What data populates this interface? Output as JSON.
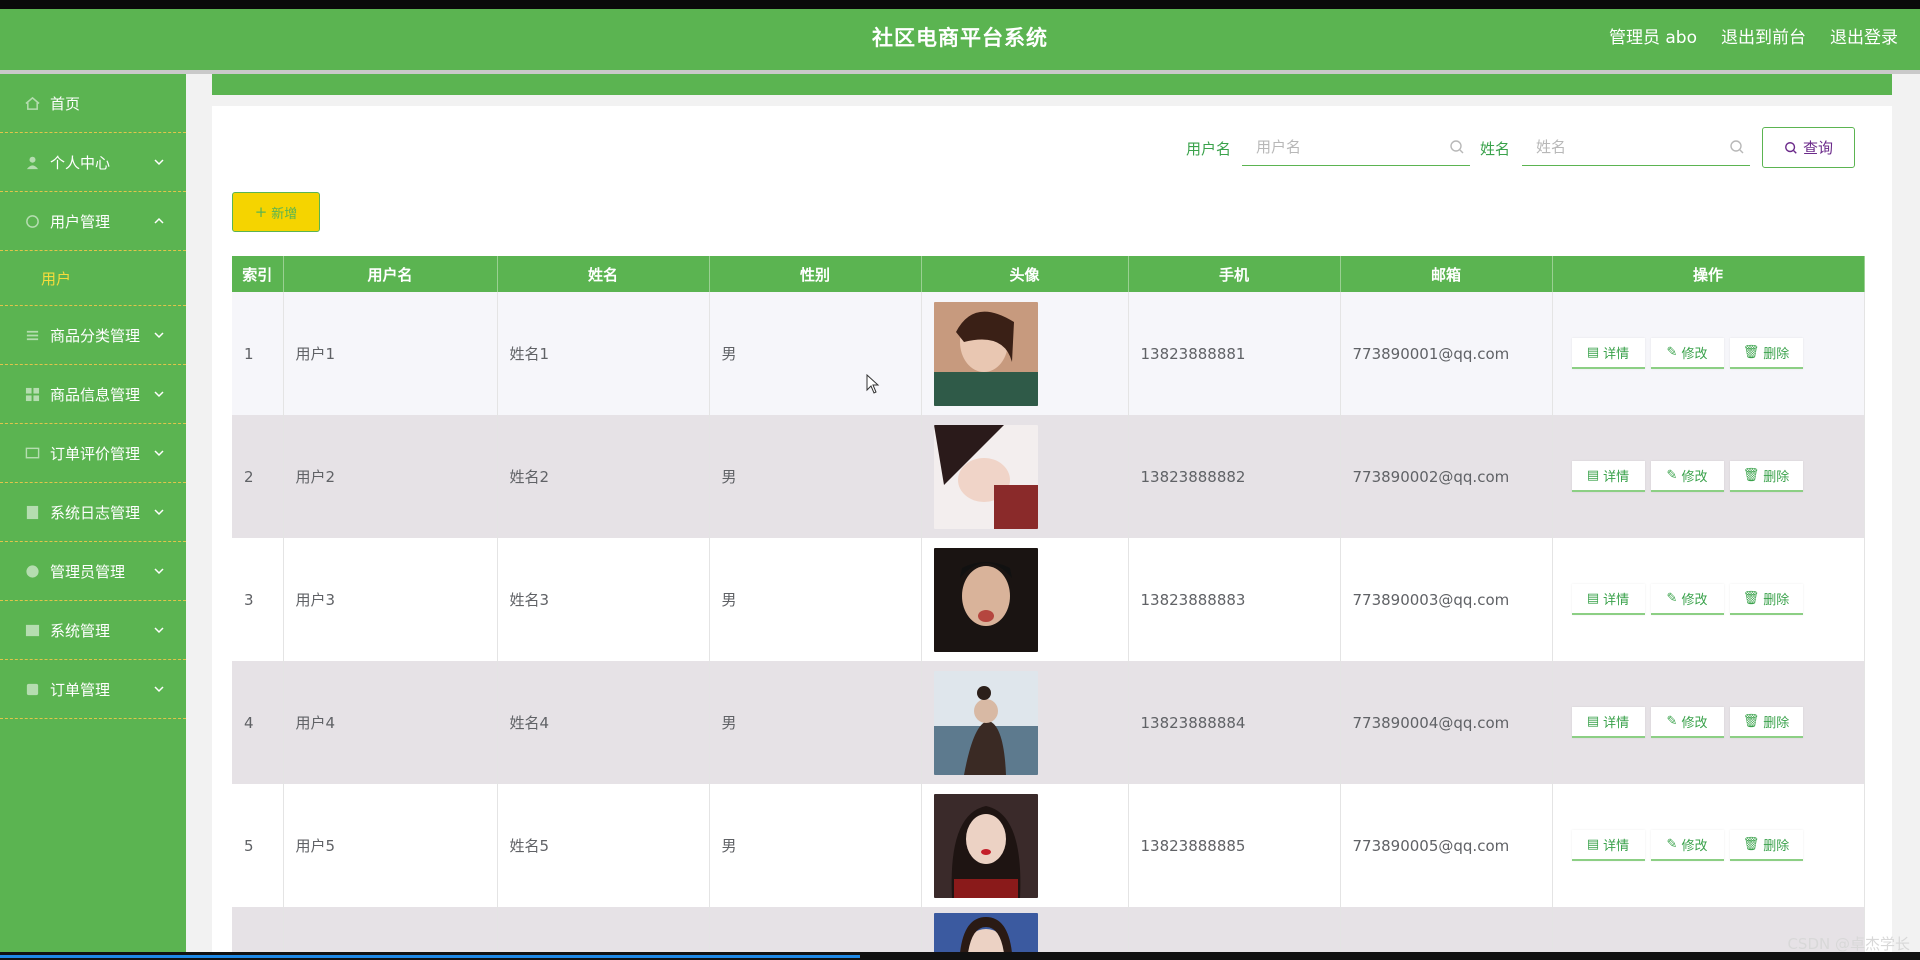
{
  "header": {
    "title": "社区电商平台系统",
    "admin_label": "管理员 abo",
    "front_link": "退出到前台",
    "logout_link": "退出登录"
  },
  "sidebar": {
    "items": [
      {
        "label": "首页",
        "icon": "home-icon"
      },
      {
        "label": "个人中心",
        "icon": "user-icon"
      },
      {
        "label": "用户管理",
        "icon": "users-icon",
        "expanded": true
      },
      {
        "label": "商品分类管理",
        "icon": "list-icon"
      },
      {
        "label": "商品信息管理",
        "icon": "grid-icon"
      },
      {
        "label": "订单评价管理",
        "icon": "comment-icon"
      },
      {
        "label": "系统日志管理",
        "icon": "log-icon"
      },
      {
        "label": "管理员管理",
        "icon": "admin-icon"
      },
      {
        "label": "系统管理",
        "icon": "settings-icon"
      },
      {
        "label": "订单管理",
        "icon": "order-icon"
      }
    ],
    "subitem": "用户"
  },
  "search": {
    "username_label": "用户名",
    "username_placeholder": "用户名",
    "name_label": "姓名",
    "name_placeholder": "姓名",
    "query_button": "查询"
  },
  "add_button": "新增",
  "table": {
    "headers": [
      "索引",
      "用户名",
      "姓名",
      "性别",
      "头像",
      "手机",
      "邮箱",
      "操作"
    ],
    "rows": [
      {
        "index": "1",
        "username": "用户1",
        "name": "姓名1",
        "gender": "男",
        "phone": "13823888881",
        "email": "773890001@qq.com"
      },
      {
        "index": "2",
        "username": "用户2",
        "name": "姓名2",
        "gender": "男",
        "phone": "13823888882",
        "email": "773890002@qq.com"
      },
      {
        "index": "3",
        "username": "用户3",
        "name": "姓名3",
        "gender": "男",
        "phone": "13823888883",
        "email": "773890003@qq.com"
      },
      {
        "index": "4",
        "username": "用户4",
        "name": "姓名4",
        "gender": "男",
        "phone": "13823888884",
        "email": "773890004@qq.com"
      },
      {
        "index": "5",
        "username": "用户5",
        "name": "姓名5",
        "gender": "男",
        "phone": "13823888885",
        "email": "773890005@qq.com"
      }
    ],
    "actions": {
      "detail": "详情",
      "edit": "修改",
      "delete": "删除"
    }
  },
  "watermark": "CSDN @卓杰学长",
  "colors": {
    "primary": "#5bb451",
    "accent_yellow": "#f5d400",
    "row_alt": "#e6e2e6"
  }
}
